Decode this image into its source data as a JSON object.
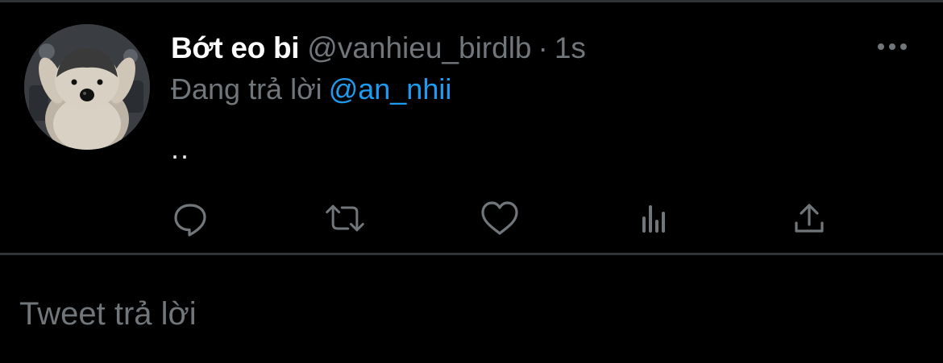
{
  "tweet": {
    "display_name": "Bớt eo bi",
    "handle": "@vanhieu_birdlb",
    "separator": "·",
    "timestamp": "1s",
    "reply_prefix": "Đang trả lời",
    "reply_mention": "@an_nhii",
    "text": ".."
  },
  "icons": {
    "avatar": "penguin-avatar",
    "more": "more-dots-icon",
    "reply": "comment-bubble-icon",
    "retweet": "retweet-icon",
    "like": "heart-icon",
    "analytics": "analytics-bars-icon",
    "share": "share-upload-icon"
  },
  "reply_box": {
    "placeholder": "Tweet trả lời",
    "value": ""
  },
  "colors": {
    "background": "#000000",
    "primary_text": "#e7e9ea",
    "secondary_text": "#71767b",
    "accent": "#1d9bf0",
    "divider": "#2f3336"
  }
}
